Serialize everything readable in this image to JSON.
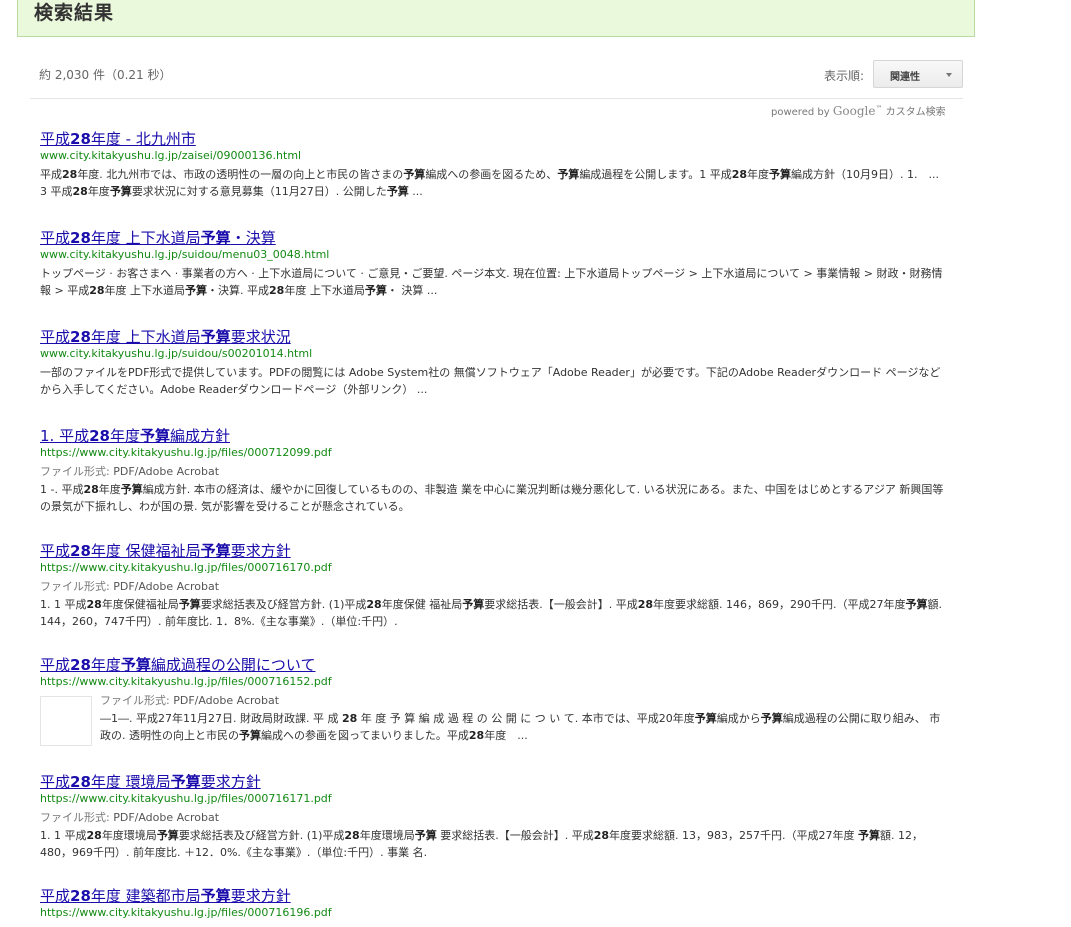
{
  "header": {
    "title": "検索結果"
  },
  "stats": {
    "text": "約 2,030 件（0.21 秒）"
  },
  "sort": {
    "label": "表示順:",
    "value": "関連性"
  },
  "powered": {
    "prefix": "powered by",
    "brand": "Google",
    "tm": "™",
    "suffix": "カスタム検索"
  },
  "file_type_prefix": "ファイル形式:",
  "results": [
    {
      "title_parts": [
        "平成",
        "28",
        "年度 - 北九州市"
      ],
      "url": "www.city.kitakyushu.lg.jp/zaisei/09000136.html",
      "snippet_parts": [
        "平成",
        "28",
        "年度. 北九州市では、市政の透明性の一層の向上と市民の皆さまの",
        "予算",
        "編成への参画を図るため、",
        "予算",
        "編成過程を公開します。1 平成",
        "28",
        "年度",
        "予算",
        "編成方針（10月9日）. 1.　... 3 平成",
        "28",
        "年度",
        "予算",
        "要求状況に対する意見募集（11月27日）. 公開した",
        "予算",
        " ..."
      ]
    },
    {
      "title_parts": [
        "平成",
        "28",
        "年度 上下水道局",
        "予算",
        "・決算"
      ],
      "url": "www.city.kitakyushu.lg.jp/suidou/menu03_0048.html",
      "snippet_parts": [
        "トップページ · お客さまへ · 事業者の方へ · 上下水道局について · ご意見・ご要望. ページ本文. 現在位置: 上下水道局トップページ > 上下水道局について > 事業情報 > 財政・財務情報 > 平成",
        "28",
        "年度 上下水道局",
        "予算",
        "・決算. 平成",
        "28",
        "年度 上下水道局",
        "予算",
        "・ 決算 ..."
      ]
    },
    {
      "title_parts": [
        "平成",
        "28",
        "年度 上下水道局",
        "予算",
        "要求状況"
      ],
      "url": "www.city.kitakyushu.lg.jp/suidou/s00201014.html",
      "snippet_parts": [
        "一部のファイルをPDF形式で提供しています。PDFの閲覧には Adobe System社の 無償ソフトウェア「Adobe Reader」が必要です。下記のAdobe Readerダウンロード ページなどから入手してください。Adobe Readerダウンロードページ（外部リンク） ..."
      ]
    },
    {
      "title_parts": [
        "1. 平成",
        "28",
        "年度",
        "予算",
        "編成方針"
      ],
      "url": "https://www.city.kitakyushu.lg.jp/files/000712099.pdf",
      "file_type": "PDF/Adobe Acrobat",
      "snippet_parts": [
        "1 -. 平成",
        "28",
        "年度",
        "予算",
        "編成方針. 本市の経済は、緩やかに回復しているものの、非製造 業を中心に業況判断は幾分悪化して. いる状況にある。また、中国をはじめとするアジア 新興国等の景気が下振れし、わが国の景. 気が影響を受けることが懸念されている。"
      ]
    },
    {
      "title_parts": [
        "平成",
        "28",
        "年度 保健福祉局",
        "予算",
        "要求方針"
      ],
      "url": "https://www.city.kitakyushu.lg.jp/files/000716170.pdf",
      "file_type": "PDF/Adobe Acrobat",
      "snippet_parts": [
        "1. 1 平成",
        "28",
        "年度保健福祉局",
        "予算",
        "要求総括表及び経営方針. (1)平成",
        "28",
        "年度保健 福祉局",
        "予算",
        "要求総括表.【一般会計】. 平成",
        "28",
        "年度要求総額. 146，869，290千円.（平成27年度",
        "予算",
        "額. 144，260，747千円）. 前年度比. 1．8%.《主な事業》.（単位:千円）."
      ]
    },
    {
      "title_parts": [
        "平成",
        "28",
        "年度",
        "予算",
        "編成過程の公開について"
      ],
      "url": "https://www.city.kitakyushu.lg.jp/files/000716152.pdf",
      "file_type": "PDF/Adobe Acrobat",
      "snippet_parts": [
        "―1―. 平成27年11月27日. 財政局財政課. 平 成 ",
        "28",
        " 年 度 予 算 編 成 過 程 の 公 開 に つ い て. 本市では、平成20年度",
        "予算",
        "編成から",
        "予算",
        "編成過程の公開に取り組み、 市政の. 透明性の向上と市民の",
        "予算",
        "編成への参画を図ってまいりました。平成",
        "28",
        "年度　..."
      ]
    },
    {
      "title_parts": [
        "平成",
        "28",
        "年度 環境局",
        "予算",
        "要求方針"
      ],
      "url": "https://www.city.kitakyushu.lg.jp/files/000716171.pdf",
      "file_type": "PDF/Adobe Acrobat",
      "snippet_parts": [
        "1. 1 平成",
        "28",
        "年度環境局",
        "予算",
        "要求総括表及び経営方針. (1)平成",
        "28",
        "年度環境局",
        "予算",
        " 要求総括表.【一般会計】. 平成",
        "28",
        "年度要求総額. 13，983，257千円.（平成27年度 ",
        "予算",
        "額. 12，480，969千円）. 前年度比. ＋12．0%.《主な事業》.（単位:千円）. 事業 名."
      ]
    },
    {
      "title_parts": [
        "平成",
        "28",
        "年度 建築都市局",
        "予算",
        "要求方針"
      ],
      "url": "https://www.city.kitakyushu.lg.jp/files/000716196.pdf"
    }
  ]
}
